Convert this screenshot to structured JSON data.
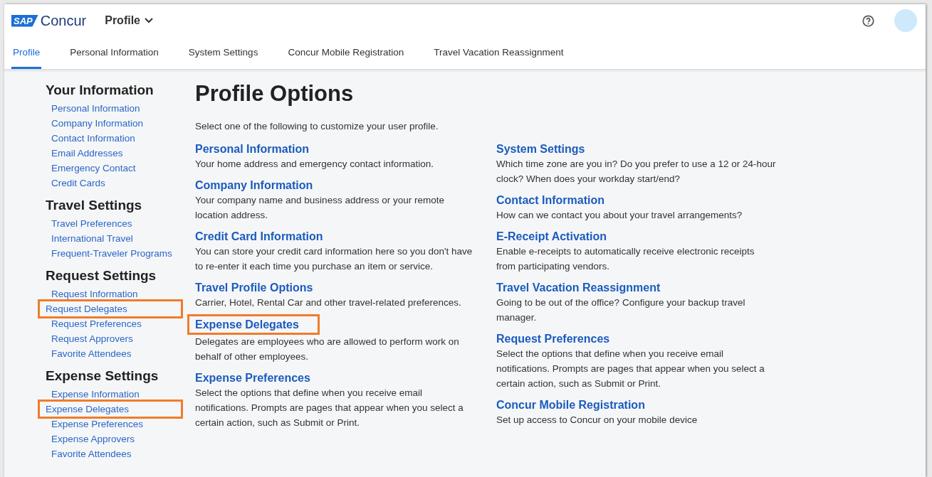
{
  "header": {
    "logo_mark": "SAP",
    "logo_text": "Concur",
    "menu": "Profile"
  },
  "tabs": [
    {
      "label": "Profile",
      "selected": true
    },
    {
      "label": "Personal Information",
      "selected": false
    },
    {
      "label": "System Settings",
      "selected": false
    },
    {
      "label": "Concur Mobile Registration",
      "selected": false
    },
    {
      "label": "Travel Vacation Reassignment",
      "selected": false
    }
  ],
  "sidebar": [
    {
      "title": "Your Information",
      "items": [
        {
          "label": "Personal Information",
          "highlighted": false
        },
        {
          "label": "Company Information",
          "highlighted": false
        },
        {
          "label": "Contact Information",
          "highlighted": false
        },
        {
          "label": "Email Addresses",
          "highlighted": false
        },
        {
          "label": "Emergency Contact",
          "highlighted": false
        },
        {
          "label": "Credit Cards",
          "highlighted": false
        }
      ]
    },
    {
      "title": "Travel Settings",
      "items": [
        {
          "label": "Travel Preferences",
          "highlighted": false
        },
        {
          "label": "International Travel",
          "highlighted": false
        },
        {
          "label": "Frequent-Traveler Programs",
          "highlighted": false
        }
      ]
    },
    {
      "title": "Request Settings",
      "items": [
        {
          "label": "Request Information",
          "highlighted": false
        },
        {
          "label": "Request Delegates",
          "highlighted": true
        },
        {
          "label": "Request Preferences",
          "highlighted": false
        },
        {
          "label": "Request Approvers",
          "highlighted": false
        },
        {
          "label": "Favorite Attendees",
          "highlighted": false
        }
      ]
    },
    {
      "title": "Expense Settings",
      "items": [
        {
          "label": "Expense Information",
          "highlighted": false
        },
        {
          "label": "Expense Delegates",
          "highlighted": true
        },
        {
          "label": "Expense Preferences",
          "highlighted": false
        },
        {
          "label": "Expense Approvers",
          "highlighted": false
        },
        {
          "label": "Favorite Attendees",
          "highlighted": false
        }
      ]
    }
  ],
  "main": {
    "title": "Profile Options",
    "intro": "Select one of the following to customize your user profile.",
    "columns": [
      [
        {
          "title": "Personal Information",
          "description": "Your home address and emergency contact information.",
          "highlighted": false
        },
        {
          "title": "Company Information",
          "description": "Your company name and business address or your remote location address.",
          "highlighted": false
        },
        {
          "title": "Credit Card Information",
          "description": "You can store your credit card information here so you don't have to re-enter it each time you purchase an item or service.",
          "highlighted": false
        },
        {
          "title": "Travel Profile Options",
          "description": "Carrier, Hotel, Rental Car and other travel-related preferences.",
          "highlighted": false
        },
        {
          "title": "Expense Delegates",
          "description": "Delegates are employees who are allowed to perform work on behalf of other employees.",
          "highlighted": true
        },
        {
          "title": "Expense Preferences",
          "description": "Select the options that define when you receive email notifications. Prompts are pages that appear when you select a certain action, such as Submit or Print.",
          "highlighted": false
        }
      ],
      [
        {
          "title": "System Settings",
          "description": "Which time zone are you in? Do you prefer to use a 12 or 24-hour clock? When does your workday start/end?",
          "highlighted": false
        },
        {
          "title": "Contact Information",
          "description": "How can we contact you about your travel arrangements?",
          "highlighted": false
        },
        {
          "title": "E-Receipt Activation",
          "description": "Enable e-receipts to automatically receive electronic receipts from participating vendors.",
          "highlighted": false
        },
        {
          "title": "Travel Vacation Reassignment",
          "description": "Going to be out of the office? Configure your backup travel manager.",
          "highlighted": false
        },
        {
          "title": "Request Preferences",
          "description": "Select the options that define when you receive email notifications. Prompts are pages that appear when you select a certain action, such as Submit or Print.",
          "highlighted": false
        },
        {
          "title": "Concur Mobile Registration",
          "description": "Set up access to Concur on your mobile device",
          "highlighted": false
        }
      ]
    ]
  }
}
